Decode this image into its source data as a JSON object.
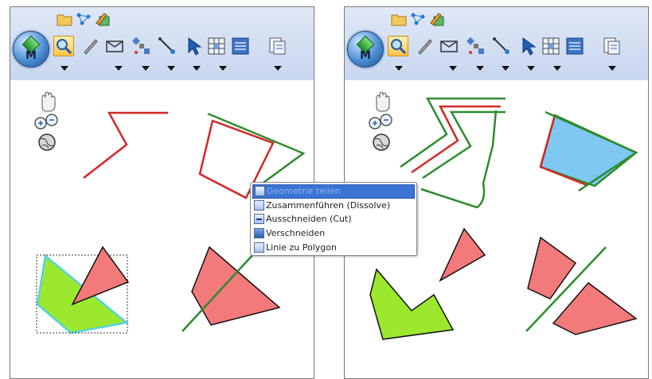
{
  "context_menu": {
    "items": [
      {
        "label": "Geometrie teilen",
        "icon": "split-geometry-icon",
        "highlighted": true
      },
      {
        "label": "Zusammenführen (Dissolve)",
        "icon": "dissolve-icon",
        "highlighted": false
      },
      {
        "label": "Ausschneiden (Cut)",
        "icon": "cut-icon",
        "highlighted": false
      },
      {
        "label": "Verschneiden",
        "icon": "intersect-icon",
        "highlighted": false
      },
      {
        "label": "Linie zu Polygon",
        "icon": "line-to-polygon-icon",
        "highlighted": false
      }
    ]
  },
  "toolbar": {
    "app_button": "M",
    "quick_access": [
      "folder-icon",
      "network-icon",
      "pencil-check-icon"
    ],
    "tools": [
      "zoom-icon",
      "pencil-icon",
      "envelope-shape-icon",
      "satellite-icon",
      "connector-icon",
      "select-arrow-icon",
      "grid-select-icon",
      "table-icon",
      "report-icon"
    ]
  },
  "navigation": [
    "pan-hand-icon",
    "zoom-in-out-icon",
    "globe-icon"
  ],
  "colors": {
    "red_line": "#d42727",
    "green_line": "#2e8b2e",
    "salmon_fill": "#f37a7a",
    "lime_fill": "#9be82e",
    "lightblue_fill": "#7ec8f2",
    "highlight_blue": "#3a73d4"
  }
}
